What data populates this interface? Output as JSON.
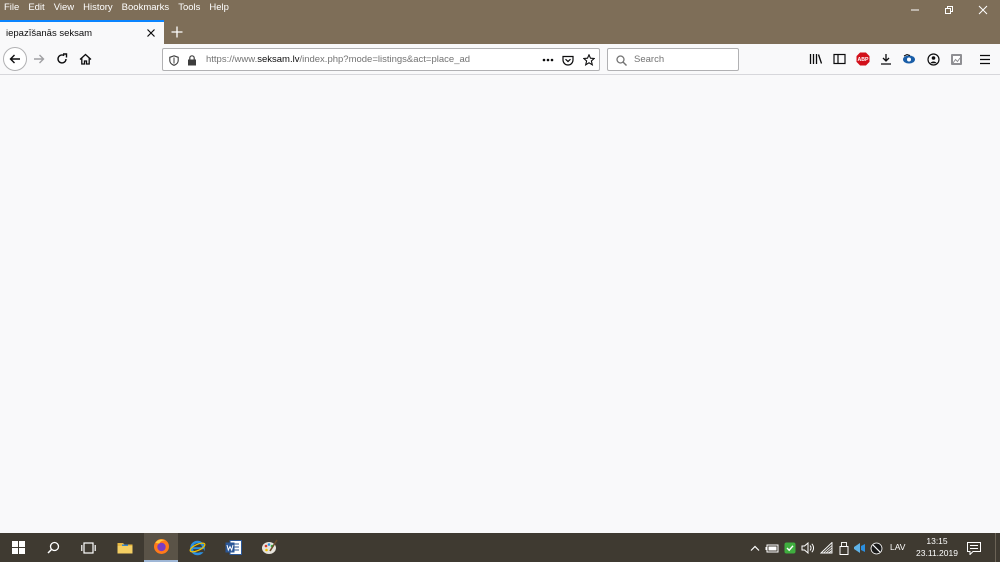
{
  "menu": [
    "File",
    "Edit",
    "View",
    "History",
    "Bookmarks",
    "Tools",
    "Help"
  ],
  "tab": {
    "title": "iepazīšanās seksam"
  },
  "url": {
    "prefix": "https://www.",
    "domain": "seksam.lv",
    "path": "/index.php?mode=listings&act=place_ad"
  },
  "search": {
    "placeholder": "Search"
  },
  "toolbar_icons": [
    "library-icon",
    "sidebar-icon",
    "adblock-plus-icon",
    "download-icon",
    "extension-icon",
    "account-icon",
    "screenshot-icon",
    "hamburger-menu-icon"
  ],
  "adblock_label": "ABP",
  "taskbar": {
    "apps": [
      "start-icon",
      "search-icon",
      "task-view-icon",
      "file-explorer-icon",
      "firefox-icon",
      "internet-explorer-icon",
      "word-icon",
      "paint-icon"
    ],
    "language": "LAV",
    "time": "13:15",
    "date": "23.11.2019"
  },
  "colors": {
    "titlebar": "#7e6e58",
    "tab_accent": "#0a84ff",
    "taskbar": "#3f3a31"
  }
}
